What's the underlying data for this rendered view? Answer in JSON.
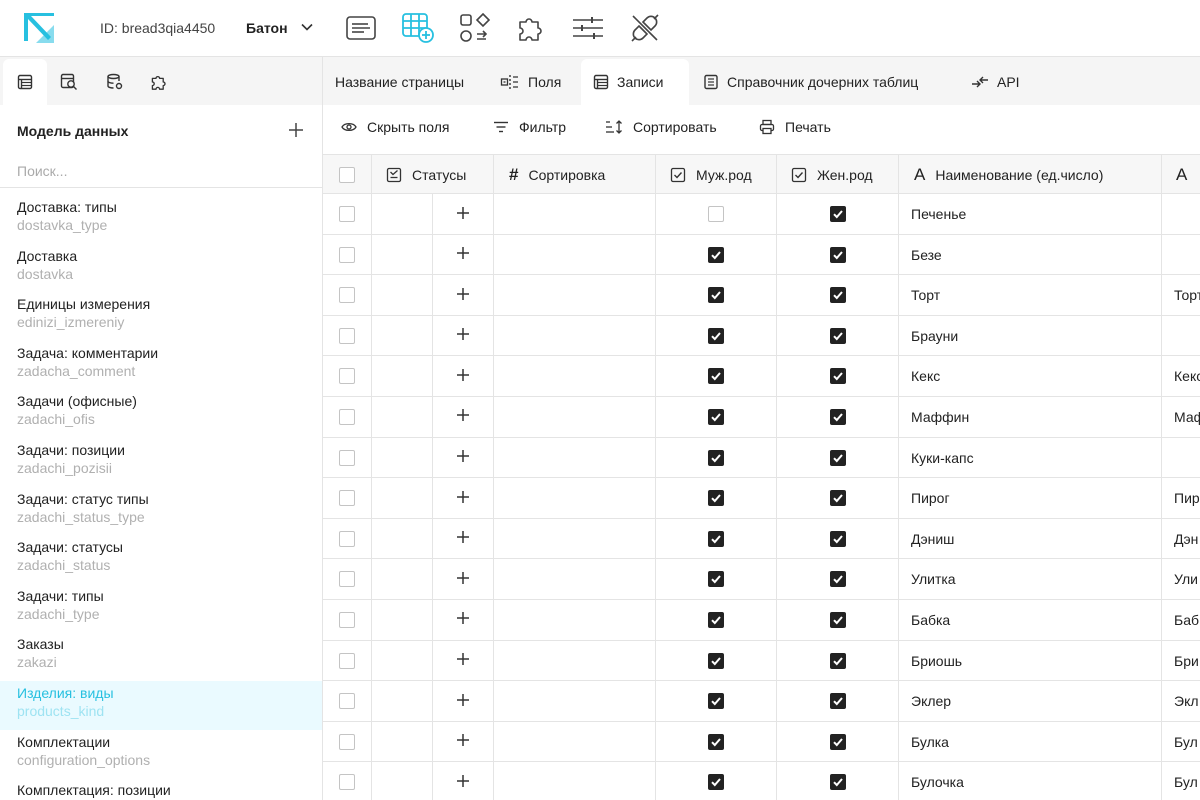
{
  "app": {
    "id_text": "ID: bread3qia4450",
    "name": "Батон"
  },
  "toolbar_icons": [
    "page-icon",
    "table-add-icon",
    "components-icon",
    "puzzle-icon",
    "sliders-icon",
    "plug-off-icon"
  ],
  "colors": {
    "accent": "#27c0e0",
    "active_bg": "#eafaff",
    "border": "#e4e4e4"
  },
  "sidebar": {
    "tab_icons": [
      "table-icon",
      "table-search-icon",
      "database-settings-icon",
      "puzzle-icon"
    ],
    "title": "Модель данных",
    "search_placeholder": "Поиск...",
    "items": [
      {
        "name": "Доставка: типы",
        "code": "dostavka_type"
      },
      {
        "name": "Доставка",
        "code": "dostavka"
      },
      {
        "name": "Единицы измерения",
        "code": "edinizi_izmereniy"
      },
      {
        "name": "Задача: комментарии",
        "code": "zadacha_comment"
      },
      {
        "name": "Задачи (офисные)",
        "code": "zadachi_ofis"
      },
      {
        "name": "Задачи: позиции",
        "code": "zadachi_pozisii"
      },
      {
        "name": "Задачи: статус типы",
        "code": "zadachi_status_type"
      },
      {
        "name": "Задачи: статусы",
        "code": "zadachi_status"
      },
      {
        "name": "Задачи: типы",
        "code": "zadachi_type"
      },
      {
        "name": "Заказы",
        "code": "zakazi"
      },
      {
        "name": "Изделия: виды",
        "code": "products_kind",
        "active": true
      },
      {
        "name": "Комплектации",
        "code": "configuration_options"
      },
      {
        "name": "Комплектация: позиции",
        "code": ""
      }
    ]
  },
  "main": {
    "tabs": [
      {
        "label": "Название страницы",
        "icon": ""
      },
      {
        "label": "Поля",
        "icon": "fields-icon"
      },
      {
        "label": "Записи",
        "icon": "table-icon",
        "active": true
      },
      {
        "label": "Справочник дочерних таблиц",
        "icon": "list-icon"
      },
      {
        "label": "API",
        "icon": "api-icon"
      }
    ],
    "toolbar": {
      "hide_fields": "Скрыть поля",
      "filter": "Фильтр",
      "sort": "Сортировать",
      "print": "Печать"
    },
    "columns": {
      "statuses": "Статусы",
      "sort": "Сортировка",
      "male": "Муж.род",
      "female": "Жен.род",
      "name": "Наименование (ед.число)",
      "next_icon": "A"
    },
    "rows": [
      {
        "male": false,
        "female": true,
        "name": "Печенье",
        "extra": ""
      },
      {
        "male": true,
        "female": true,
        "name": "Безе",
        "extra": ""
      },
      {
        "male": true,
        "female": true,
        "name": "Торт",
        "extra": "Торт"
      },
      {
        "male": true,
        "female": true,
        "name": "Брауни",
        "extra": ""
      },
      {
        "male": true,
        "female": true,
        "name": "Кекс",
        "extra": "Кекс"
      },
      {
        "male": true,
        "female": true,
        "name": "Маффин",
        "extra": "Маф"
      },
      {
        "male": true,
        "female": true,
        "name": "Куки-капс",
        "extra": ""
      },
      {
        "male": true,
        "female": true,
        "name": "Пирог",
        "extra": "Пир"
      },
      {
        "male": true,
        "female": true,
        "name": "Дэниш",
        "extra": "Дэн"
      },
      {
        "male": true,
        "female": true,
        "name": "Улитка",
        "extra": "Ули"
      },
      {
        "male": true,
        "female": true,
        "name": "Бабка",
        "extra": "Баб"
      },
      {
        "male": true,
        "female": true,
        "name": "Бриошь",
        "extra": "Бри"
      },
      {
        "male": true,
        "female": true,
        "name": "Эклер",
        "extra": "Экл"
      },
      {
        "male": true,
        "female": true,
        "name": "Булка",
        "extra": "Бул"
      },
      {
        "male": true,
        "female": true,
        "name": "Булочка",
        "extra": "Бул"
      }
    ]
  }
}
